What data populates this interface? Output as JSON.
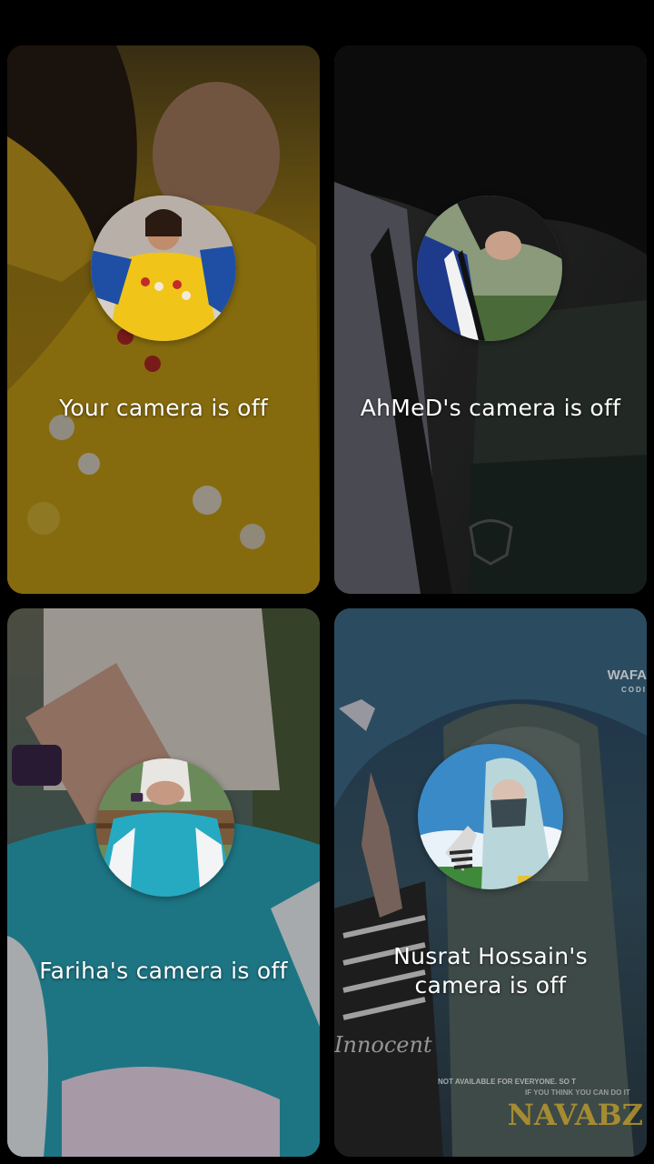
{
  "tiles": [
    {
      "label": "Your camera is off",
      "avatar": "bride-in-yellow-avatar"
    },
    {
      "label": "AhMeD's camera is off",
      "avatar": "man-in-suit-avatar"
    },
    {
      "label": "Fariha's camera is off",
      "avatar": "woman-in-teal-dress-avatar"
    },
    {
      "label": "Nusrat Hossain's camera is off",
      "avatar": "woman-in-hijab-avatar"
    }
  ],
  "watermarks": {
    "tile4_top": "WAFA",
    "tile4_top_sub": "CODI",
    "tile4_bottom_left": "Innocent",
    "tile4_bottom_line1": "NOT AVAILABLE FOR EVERYONE. SO T",
    "tile4_bottom_line2": "IF YOU THINK YOU CAN DO IT",
    "tile4_bottom_brand": "NAVABZ"
  }
}
